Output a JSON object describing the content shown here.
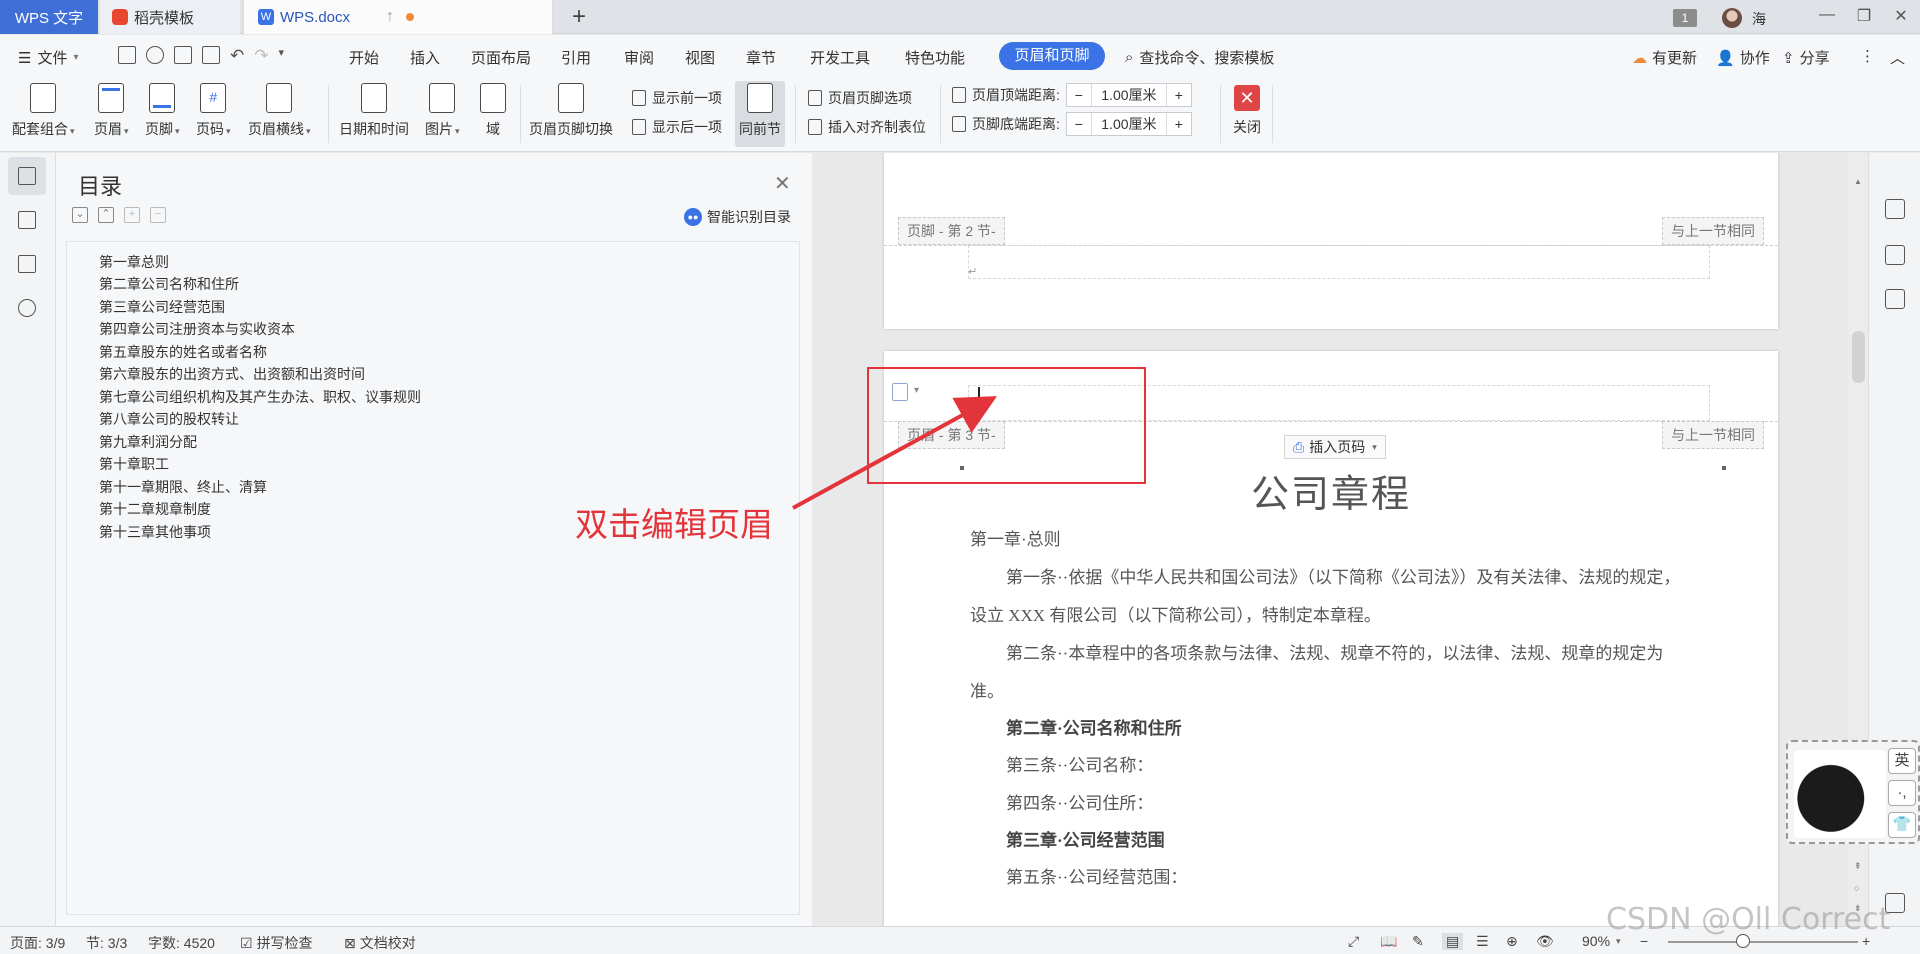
{
  "titlebar": {
    "tabs": [
      {
        "label": "WPS 文字"
      },
      {
        "label": "稻壳模板"
      },
      {
        "label": "WPS.docx"
      }
    ],
    "badge": "1",
    "user": "海"
  },
  "menubar": {
    "file": "文件",
    "items": [
      "开始",
      "插入",
      "页面布局",
      "引用",
      "审阅",
      "视图",
      "章节",
      "开发工具",
      "特色功能"
    ],
    "active": "页眉和页脚",
    "search": "查找命令、搜索模板",
    "update": "有更新",
    "collab": "协作",
    "share": "分享"
  },
  "ribbon": {
    "combo": "配套组合",
    "header": "页眉",
    "footer": "页脚",
    "page_num": "页码",
    "header_line": "页眉横线",
    "datetime": "日期和时间",
    "picture": "图片",
    "field": "域",
    "switch": "页眉页脚切换",
    "show_prev": "显示前一项",
    "show_next": "显示后一项",
    "same_prev": "同前节",
    "hf_options": "页眉页脚选项",
    "insert_tab": "插入对齐制表位",
    "top_dist_label": "页眉顶端距离:",
    "top_dist_value": "1.00厘米",
    "bottom_dist_label": "页脚底端距离:",
    "bottom_dist_value": "1.00厘米",
    "close": "关闭"
  },
  "toc": {
    "title": "目录",
    "smart": "智能识别目录",
    "items": [
      "第一章总则",
      "第二章公司名称和住所",
      "第三章公司经营范围",
      "第四章公司注册资本与实收资本",
      "第五章股东的姓名或者名称",
      "第六章股东的出资方式、出资额和出资时间",
      "第七章公司组织机构及其产生办法、职权、议事规则",
      "第八章公司的股权转让",
      "第九章利润分配",
      "第十章职工",
      "第十一章期限、终止、清算",
      "第十二章规章制度",
      "第十三章其他事项"
    ]
  },
  "doc": {
    "footer_tag": "页脚 - 第 2 节-",
    "same_as_prev": "与上一节相同",
    "header_tag": "页眉 - 第 3 节-",
    "insert_page_num": "插入页码",
    "title": "公司章程",
    "lines": [
      "第一章·总则",
      "第一条··依据《中华人民共和国公司法》（以下简称《公司法》）及有关法律、法规的规定，",
      "设立 XXX 有限公司（以下简称公司），特制定本章程。",
      "第二条··本章程中的各项条款与法律、法规、规章不符的，以法律、法规、规章的规定为",
      "准。",
      "第二章·公司名称和住所",
      "第三条··公司名称：",
      "第四条··公司住所：",
      "第三章·公司经营范围",
      "第五条··公司经营范围："
    ]
  },
  "annotation": {
    "text": "双击编辑页眉",
    "color": "#e2343a"
  },
  "ime": {
    "mode": "英",
    "punct": "·,",
    "skin": "T"
  },
  "status": {
    "page": "页面: 3/9",
    "section": "节: 3/3",
    "words": "字数: 4520",
    "spell": "拼写检查",
    "proof": "文档校对",
    "zoom": "90%"
  },
  "watermark": "CSDN @Oll Correct",
  "colors": {
    "accent": "#3b73e6",
    "wps_tab": "#3f6fd6",
    "close_red": "#e04545"
  }
}
